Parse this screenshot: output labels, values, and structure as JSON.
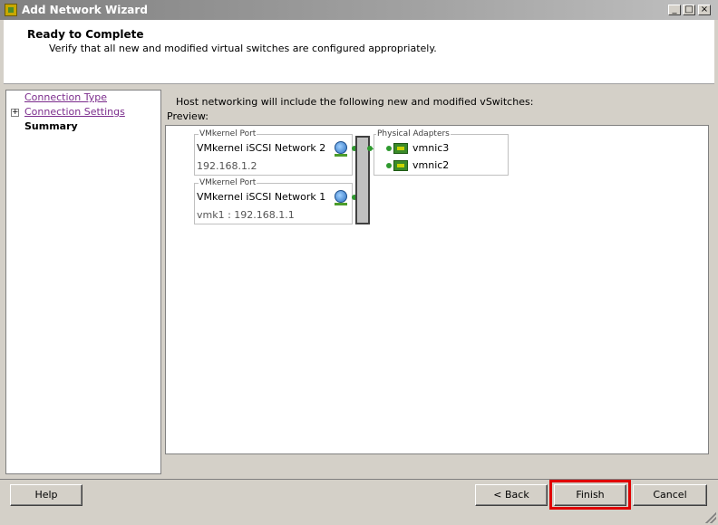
{
  "window": {
    "title": "Add Network Wizard",
    "minimize_glyph": "_",
    "maximize_glyph": "□",
    "close_glyph": "×"
  },
  "header": {
    "title": "Ready to Complete",
    "subtitle": "Verify that all new and modified virtual switches are configured appropriately."
  },
  "sidebar": {
    "expander_glyph": "+",
    "items": [
      {
        "label": "Connection Type"
      },
      {
        "label": "Connection Settings"
      },
      {
        "label": "Summary"
      }
    ]
  },
  "main": {
    "description": "Host networking will include the following new and modified vSwitches:",
    "preview_label": "Preview:",
    "ports": [
      {
        "legend": "VMkernel Port",
        "name": "VMkernel iSCSI Network 2",
        "detail": "192.168.1.2"
      },
      {
        "legend": "VMkernel Port",
        "name": "VMkernel iSCSI Network 1",
        "detail": "vmk1 : 192.168.1.1"
      }
    ],
    "adapters": {
      "legend": "Physical Adapters",
      "items": [
        {
          "name": "vmnic3"
        },
        {
          "name": "vmnic2"
        }
      ]
    }
  },
  "footer": {
    "help_label": "Help",
    "back_label": "< Back",
    "finish_label": "Finish",
    "cancel_label": "Cancel"
  },
  "colors": {
    "highlight": "#e00000",
    "link": "#7b2c8c",
    "connector": "#2f9a2f"
  }
}
